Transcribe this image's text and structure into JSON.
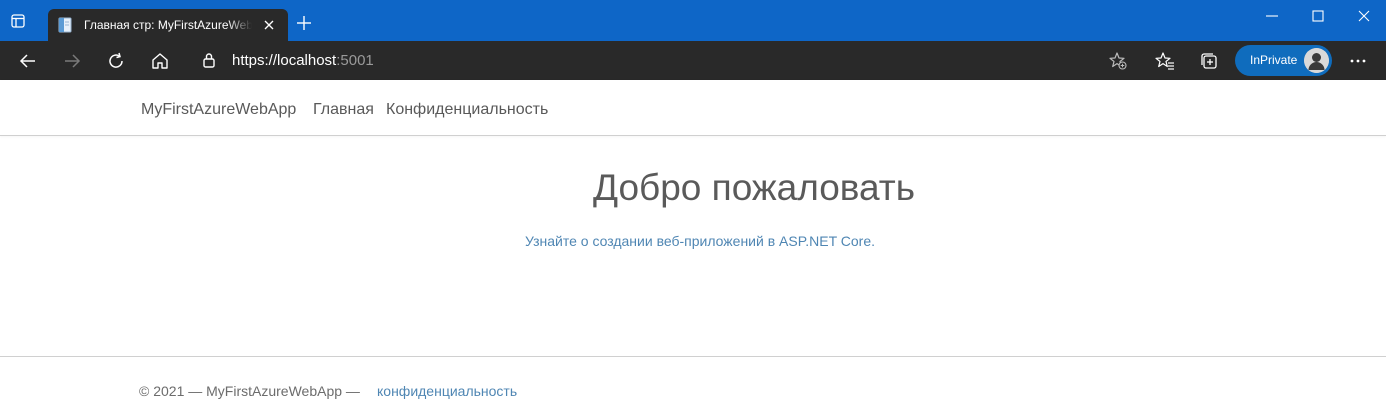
{
  "browser": {
    "tab_title": "Главная стр: MyFirstAzureWebApp",
    "url_main": "https://localhost",
    "url_port": ":5001",
    "inprivate_label": "InPrivate",
    "accent_color": "#0e66c7",
    "chrome_color": "#292929",
    "icons": {
      "tab_actions": "tab-actions-icon",
      "favicon": "page-favicon-icon",
      "close_tab": "close-icon",
      "new_tab": "plus-icon",
      "minimize": "minimize-icon",
      "maximize": "maximize-icon",
      "close_window": "close-icon",
      "back": "arrow-left-icon",
      "forward": "arrow-right-icon",
      "reload": "reload-icon",
      "home": "home-icon",
      "lock": "lock-icon",
      "add_favorite": "star-plus-icon",
      "favorites": "favorites-icon",
      "collections": "collections-icon",
      "profile": "avatar-icon",
      "more": "more-icon"
    }
  },
  "site": {
    "nav": {
      "brand": "MyFirstAzureWebApp",
      "home": "Главная",
      "privacy": "Конфиденциальность"
    },
    "main": {
      "heading": "Добро пожаловать",
      "learn_link": "Узнайте о создании веб-приложений в ASP.NET Core."
    },
    "footer": {
      "copyright": "©  2021 — MyFirstAzureWebApp —",
      "privacy_link": "конфиденциальность"
    },
    "link_color": "#4f86b3"
  }
}
